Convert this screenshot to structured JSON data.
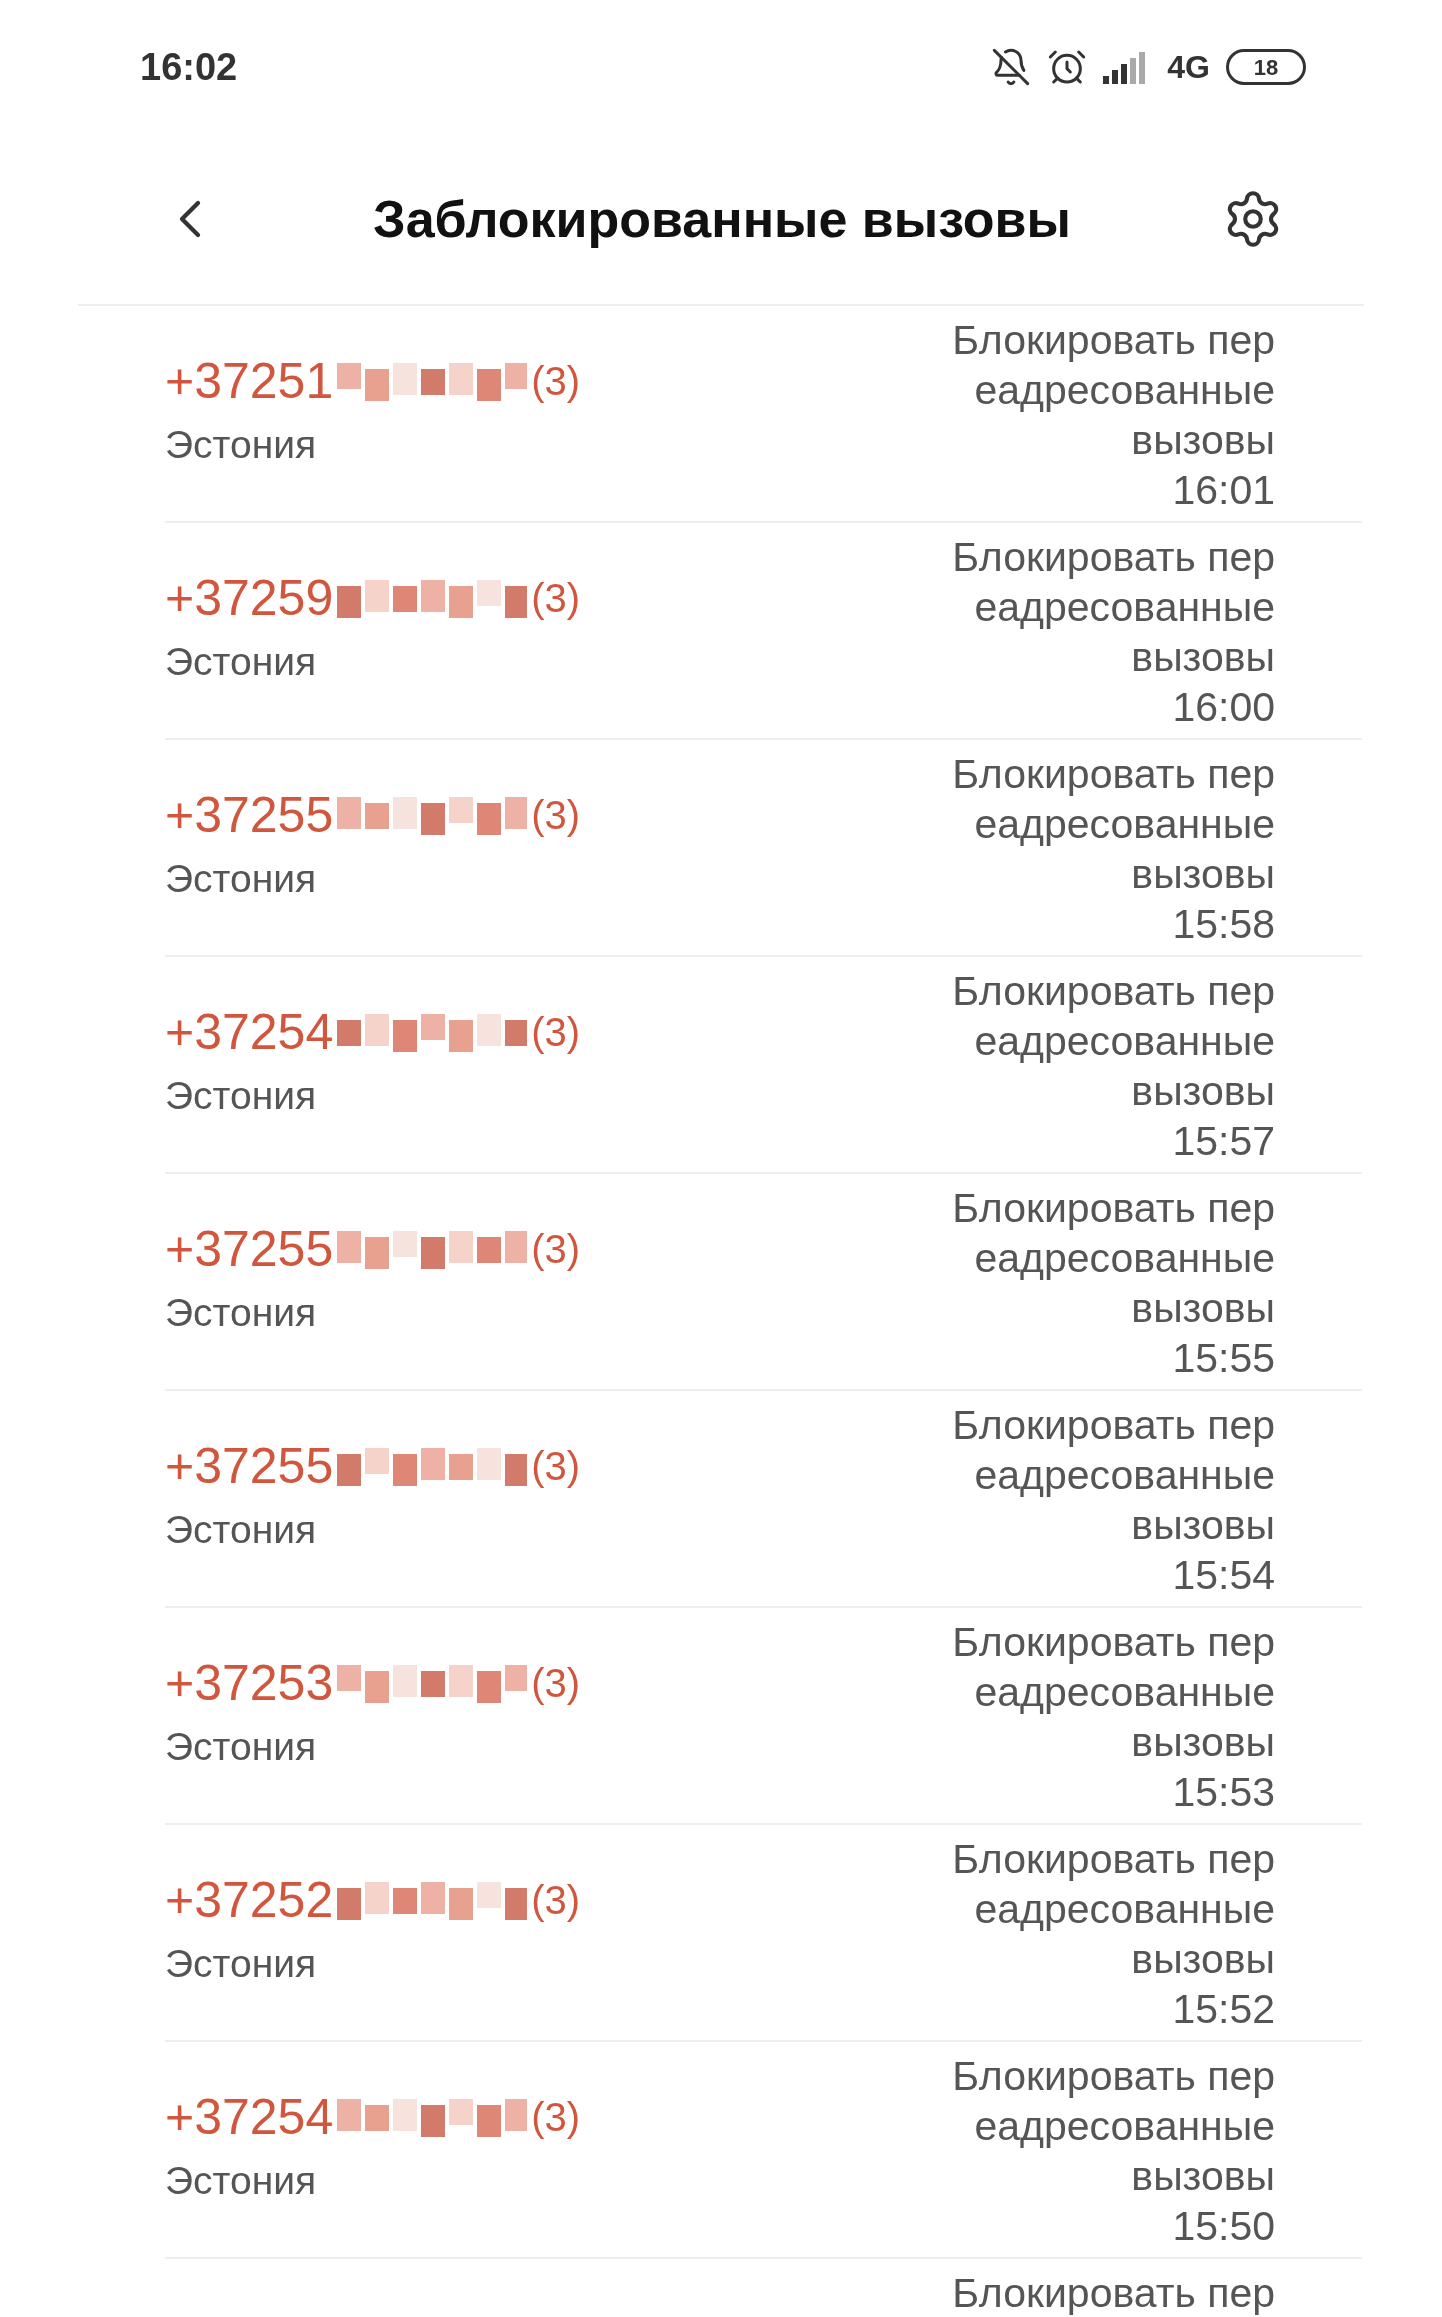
{
  "status_bar": {
    "time": "16:02",
    "network": "4G",
    "battery": "18"
  },
  "header": {
    "title": "Заблокированные вызовы"
  },
  "rows": [
    {
      "number": "+37251",
      "count": "(3)",
      "country": "Эстония",
      "reason_lines": [
        "Блокировать пер",
        "еадресованные",
        "вызовы"
      ],
      "time": "16:01"
    },
    {
      "number": "+37259",
      "count": "(3)",
      "country": "Эстония",
      "reason_lines": [
        "Блокировать пер",
        "еадресованные",
        "вызовы"
      ],
      "time": "16:00"
    },
    {
      "number": "+37255",
      "count": "(3)",
      "country": "Эстония",
      "reason_lines": [
        "Блокировать пер",
        "еадресованные",
        "вызовы"
      ],
      "time": "15:58"
    },
    {
      "number": "+37254",
      "count": "(3)",
      "country": "Эстония",
      "reason_lines": [
        "Блокировать пер",
        "еадресованные",
        "вызовы"
      ],
      "time": "15:57"
    },
    {
      "number": "+37255",
      "count": "(3)",
      "country": "Эстония",
      "reason_lines": [
        "Блокировать пер",
        "еадресованные",
        "вызовы"
      ],
      "time": "15:55"
    },
    {
      "number": "+37255",
      "count": "(3)",
      "country": "Эстония",
      "reason_lines": [
        "Блокировать пер",
        "еадресованные",
        "вызовы"
      ],
      "time": "15:54"
    },
    {
      "number": "+37253",
      "count": "(3)",
      "country": "Эстония",
      "reason_lines": [
        "Блокировать пер",
        "еадресованные",
        "вызовы"
      ],
      "time": "15:53"
    },
    {
      "number": "+37252",
      "count": "(3)",
      "country": "Эстония",
      "reason_lines": [
        "Блокировать пер",
        "еадресованные",
        "вызовы"
      ],
      "time": "15:52"
    },
    {
      "number": "+37254",
      "count": "(3)",
      "country": "Эстония",
      "reason_lines": [
        "Блокировать пер",
        "еадресованные",
        "вызовы"
      ],
      "time": "15:50"
    },
    {
      "reason_lines": [
        "Блокировать пер"
      ]
    }
  ]
}
